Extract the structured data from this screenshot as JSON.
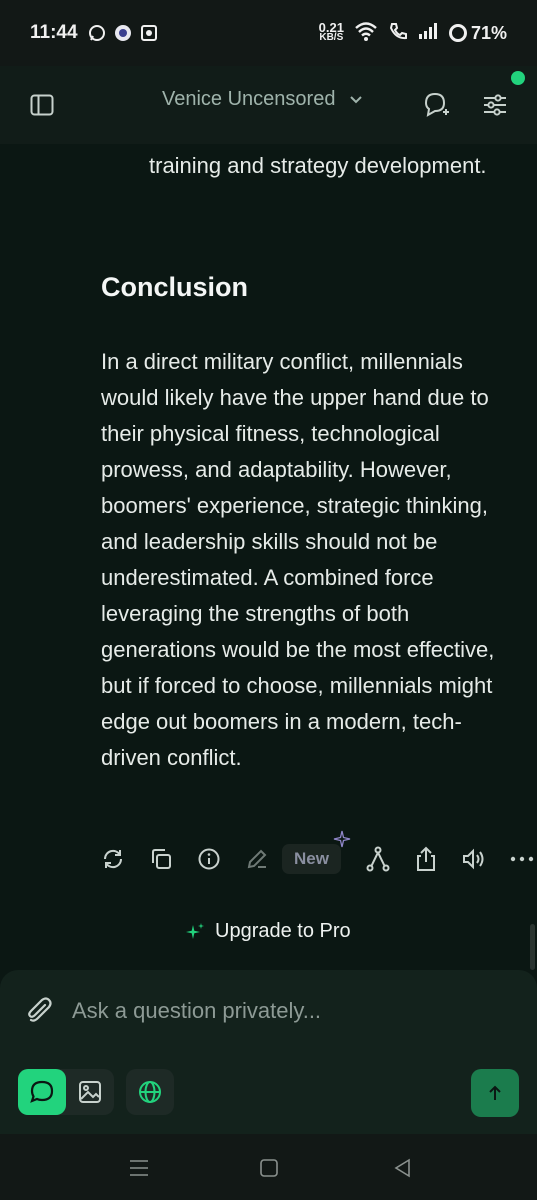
{
  "status_bar": {
    "time": "11:44",
    "net_speed_value": "0.21",
    "net_speed_unit": "KB/S",
    "battery": "71%",
    "left_icons": [
      "whatsapp-icon",
      "app-icon",
      "app-icon"
    ],
    "right_icons": [
      "wifi-icon",
      "wifi-calling-icon",
      "signal-icon",
      "battery-ring-icon"
    ]
  },
  "header": {
    "model_name": "Venice Uncensored",
    "online_indicator_color": "#22d37d"
  },
  "message": {
    "continued_text": "training and strategy development.",
    "heading": "Conclusion",
    "paragraph": "In a direct military conflict, millennials would likely have the upper hand due to their physical fitness, technological prowess, and adaptability. However, boomers' experience, strategic thinking, and leadership skills should not be underestimated. A combined force leveraging the strengths of both generations would be the most effective, but if forced to choose, millennials might edge out boomers in a modern, tech-driven conflict."
  },
  "actions": {
    "new_badge": "New",
    "icons": [
      "regenerate-icon",
      "copy-icon",
      "info-icon",
      "edit-icon",
      "fork-icon",
      "share-icon",
      "speaker-icon",
      "more-icon"
    ]
  },
  "upgrade": {
    "label": "Upgrade to Pro"
  },
  "composer": {
    "placeholder": "Ask a question privately...",
    "accent_color": "#22d37d",
    "send_color": "#1b7c4d"
  }
}
